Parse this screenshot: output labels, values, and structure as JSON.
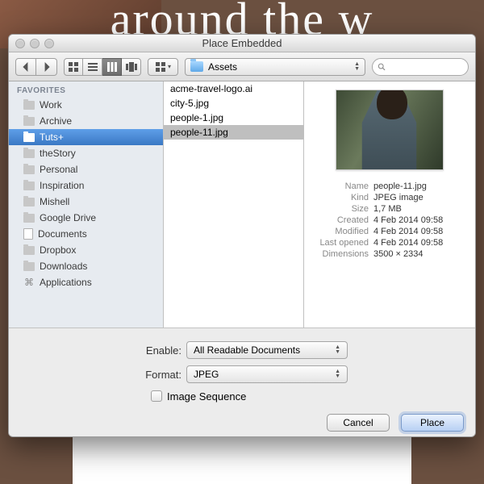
{
  "background_text": "around the w",
  "titlebar": {
    "title": "Place Embedded"
  },
  "toolbar": {
    "path_label": "Assets",
    "search_placeholder": ""
  },
  "sidebar": {
    "header": "FAVORITES",
    "items": [
      {
        "type": "folder",
        "label": "Work"
      },
      {
        "type": "folder",
        "label": "Archive"
      },
      {
        "type": "folder",
        "label": "Tuts+",
        "selected": true
      },
      {
        "type": "folder",
        "label": "theStory"
      },
      {
        "type": "folder",
        "label": "Personal"
      },
      {
        "type": "folder",
        "label": "Inspiration"
      },
      {
        "type": "folder",
        "label": "Mishell"
      },
      {
        "type": "folder",
        "label": "Google Drive"
      },
      {
        "type": "doc",
        "label": "Documents"
      },
      {
        "type": "folder",
        "label": "Dropbox"
      },
      {
        "type": "folder",
        "label": "Downloads"
      },
      {
        "type": "app",
        "label": "Applications"
      }
    ]
  },
  "files": [
    {
      "name": "acme-travel-logo.ai"
    },
    {
      "name": "city-5.jpg"
    },
    {
      "name": "people-1.jpg"
    },
    {
      "name": "people-11.jpg",
      "selected": true
    }
  ],
  "preview": {
    "fields": [
      {
        "k": "Name",
        "v": "people-11.jpg"
      },
      {
        "k": "Kind",
        "v": "JPEG image"
      },
      {
        "k": "Size",
        "v": "1,7 MB"
      },
      {
        "k": "Created",
        "v": "4 Feb 2014 09:58"
      },
      {
        "k": "Modified",
        "v": "4 Feb 2014 09:58"
      },
      {
        "k": "Last opened",
        "v": "4 Feb 2014 09:58"
      },
      {
        "k": "Dimensions",
        "v": "3500 × 2334"
      }
    ]
  },
  "form": {
    "enable_label": "Enable:",
    "enable_value": "All Readable Documents",
    "format_label": "Format:",
    "format_value": "JPEG",
    "image_sequence_label": "Image Sequence"
  },
  "buttons": {
    "cancel": "Cancel",
    "place": "Place"
  }
}
